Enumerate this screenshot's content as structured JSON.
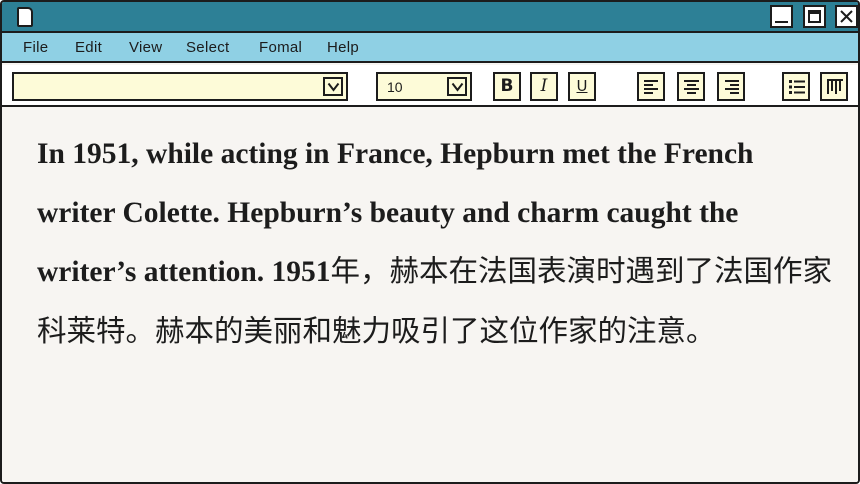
{
  "window": {
    "icons": {
      "app": "document-icon",
      "minimize": "minimize-icon",
      "maximize": "maximize-icon",
      "close": "close-icon"
    }
  },
  "menu": {
    "items": [
      "File",
      "Edit",
      "View",
      "Select",
      "Fomal",
      "Help"
    ]
  },
  "toolbar": {
    "font_name": "",
    "font_size": "10",
    "bold_label": "B",
    "italic_label": "I",
    "underline_label": "U",
    "icons": {
      "dropdown": "chevron-down-icon",
      "align_left": "align-left-icon",
      "align_center": "align-center-icon",
      "align_right": "align-right-icon",
      "list": "bulleted-list-icon",
      "columns": "columns-icon"
    }
  },
  "document": {
    "english_text": "In 1951, while acting in France, Hepburn met the French writer Colette. Hepburn’s beauty and charm caught the writer’s attention. 1951",
    "chinese_text": "年，赫本在法国表演时遇到了法国作家科莱特。赫本的美丽和魅力吸引了这位作家的注意。"
  },
  "colors": {
    "titlebar": "#2d8096",
    "menubar": "#8fd0e4",
    "toolbar": "#ffffff",
    "input_fill": "#fdfbd8",
    "document_bg": "#f7f5f2",
    "border": "#1c1c1c"
  }
}
